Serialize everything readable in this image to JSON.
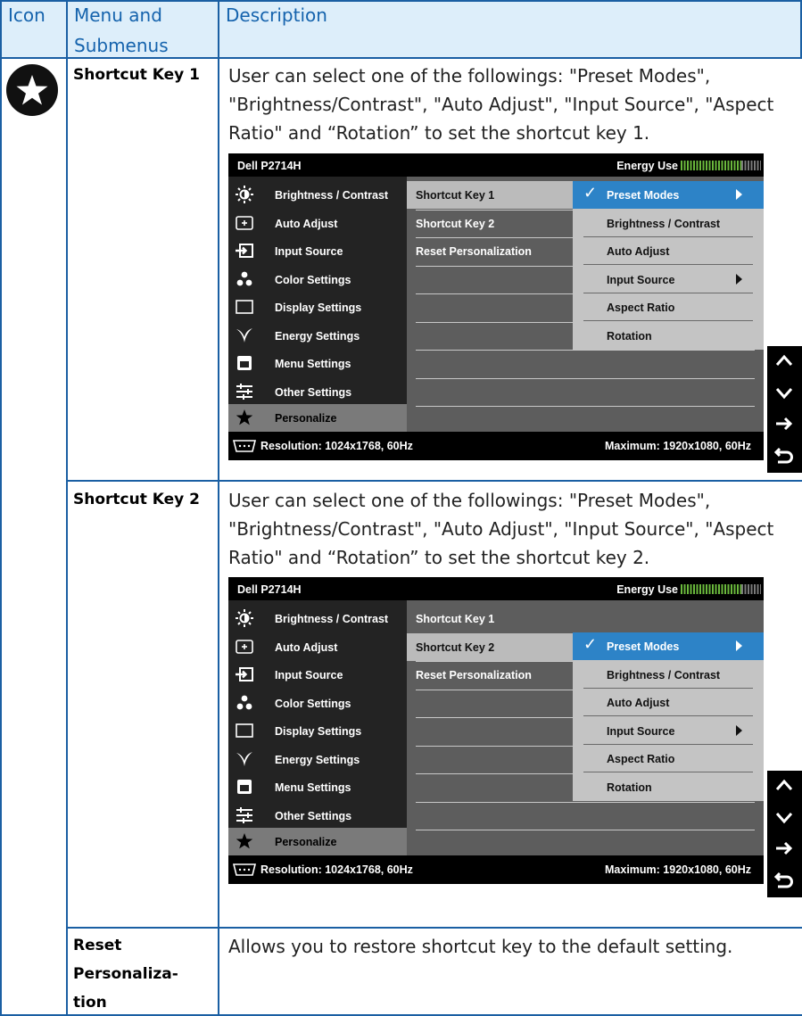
{
  "header": {
    "icon": "Icon",
    "menu_line1": "Menu and",
    "menu_line2": "Submenus",
    "description": "Description"
  },
  "icon": "star-icon",
  "colors": {
    "border": "#1a5fa3",
    "header_bg": "#ddeefa",
    "header_text": "#1563ad",
    "osd_highlight": "#2d83c7"
  },
  "rows": [
    {
      "name": "Shortcut Key 1",
      "description": "User can select one of the followings: \"Preset Modes\", \"Brightness/Contrast\", \"Auto Adjust\", \"Input Source\", \"Aspect Ratio\" and “Rotation” to set the shortcut key 1."
    },
    {
      "name": "Shortcut Key 2",
      "description": "User can select one of the followings: \"Preset Modes\", \"Brightness/Contrast\", \"Auto Adjust\", \"Input Source\", \"Aspect Ratio\" and “Rotation” to set the shortcut key 2."
    },
    {
      "name_lines": [
        "Reset",
        "Personaliza-",
        "tion"
      ],
      "description": "Allows you to restore shortcut key to the default setting."
    }
  ],
  "osd": {
    "title": "Dell P2714H",
    "energy_label": "Energy Use",
    "main_menu": [
      {
        "label": "Brightness / Contrast",
        "icon": "brightness-icon"
      },
      {
        "label": "Auto Adjust",
        "icon": "auto-adjust-icon"
      },
      {
        "label": "Input Source",
        "icon": "input-source-icon"
      },
      {
        "label": "Color Settings",
        "icon": "color-settings-icon"
      },
      {
        "label": "Display Settings",
        "icon": "display-settings-icon"
      },
      {
        "label": "Energy Settings",
        "icon": "energy-settings-icon"
      },
      {
        "label": "Menu Settings",
        "icon": "menu-settings-icon"
      },
      {
        "label": "Other Settings",
        "icon": "other-settings-icon"
      },
      {
        "label": "Personalize",
        "icon": "star-icon"
      }
    ],
    "submenu": [
      "Shortcut Key 1",
      "Shortcut Key 2",
      "Reset Personalization"
    ],
    "options": [
      {
        "label": "Preset Modes",
        "checked": true,
        "has_submenu": true
      },
      {
        "label": "Brightness / Contrast"
      },
      {
        "label": "Auto Adjust"
      },
      {
        "label": "Input Source",
        "has_submenu": true
      },
      {
        "label": "Aspect Ratio"
      },
      {
        "label": "Rotation"
      }
    ],
    "resolution": "Resolution: 1024x1768, 60Hz",
    "maximum": "Maximum: 1920x1080, 60Hz",
    "side_keys": [
      "up-arrow-icon",
      "down-arrow-icon",
      "right-arrow-icon",
      "return-icon"
    ]
  }
}
